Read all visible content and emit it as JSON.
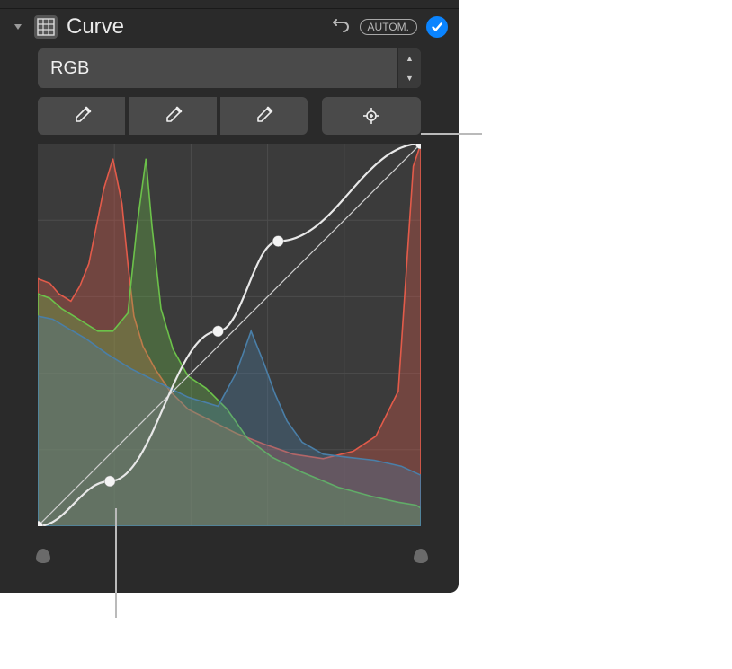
{
  "header": {
    "title": "Curve",
    "auto_label": "AUTOM."
  },
  "dropdown": {
    "value": "RGB"
  },
  "colors": {
    "accent": "#0a84ff",
    "red_series": "#e35b4a",
    "green_series": "#6cc24a",
    "blue_series": "#4a7fa8"
  },
  "chart_data": {
    "type": "area",
    "title": "",
    "xlabel": "",
    "ylabel": "",
    "xlim": [
      0,
      255
    ],
    "ylim": [
      0,
      255
    ],
    "grid": true,
    "series": [
      {
        "name": "Red",
        "color_ref": "red_series",
        "x": [
          0,
          8,
          14,
          22,
          28,
          34,
          38,
          44,
          50,
          56,
          60,
          64,
          70,
          78,
          88,
          100,
          116,
          132,
          150,
          170,
          190,
          210,
          225,
          240,
          250,
          255,
          255
        ],
        "values": [
          165,
          162,
          155,
          150,
          160,
          175,
          195,
          225,
          245,
          215,
          175,
          140,
          120,
          105,
          90,
          78,
          70,
          62,
          55,
          48,
          45,
          50,
          60,
          90,
          240,
          255,
          0
        ]
      },
      {
        "name": "Green",
        "color_ref": "green_series",
        "x": [
          0,
          8,
          16,
          24,
          32,
          40,
          50,
          60,
          66,
          72,
          76,
          82,
          90,
          100,
          112,
          126,
          140,
          156,
          176,
          200,
          222,
          240,
          252,
          255
        ],
        "values": [
          155,
          152,
          145,
          140,
          135,
          130,
          130,
          142,
          200,
          245,
          200,
          145,
          118,
          100,
          92,
          78,
          58,
          46,
          36,
          26,
          20,
          16,
          14,
          12
        ]
      },
      {
        "name": "Blue",
        "color_ref": "blue_series",
        "x": [
          0,
          10,
          20,
          32,
          46,
          62,
          80,
          100,
          120,
          132,
          142,
          150,
          158,
          166,
          176,
          190,
          206,
          224,
          242,
          255
        ],
        "values": [
          140,
          138,
          132,
          125,
          115,
          105,
          96,
          86,
          80,
          102,
          130,
          110,
          88,
          70,
          56,
          48,
          46,
          44,
          40,
          34
        ]
      }
    ],
    "curve": {
      "reference_line": [
        [
          0,
          0
        ],
        [
          255,
          255
        ]
      ],
      "points": [
        {
          "x": 0,
          "y": 0
        },
        {
          "x": 48,
          "y": 30
        },
        {
          "x": 120,
          "y": 130
        },
        {
          "x": 160,
          "y": 190
        },
        {
          "x": 255,
          "y": 255
        }
      ]
    }
  }
}
